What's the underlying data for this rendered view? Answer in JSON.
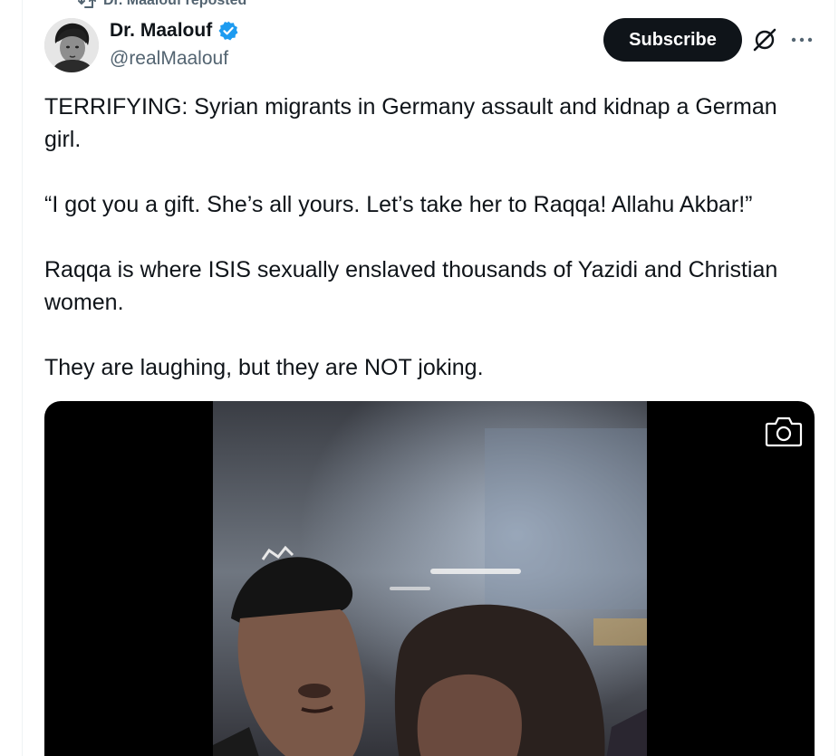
{
  "repost": {
    "text": "Dr. Maalouf reposted",
    "icon": "repost-icon"
  },
  "author": {
    "name": "Dr. Maalouf",
    "handle": "@realMaalouf",
    "verified": true,
    "verified_color": "#1d9bf0"
  },
  "actions": {
    "subscribe_label": "Subscribe",
    "grok_icon": "grok-icon",
    "more_icon": "more-icon"
  },
  "tweet": {
    "paragraphs": [
      "TERRIFYING: Syrian migrants in Germany assault and kidnap a German girl.",
      "“I got you a gift. She’s all yours. Let’s take her to Raqqa! Allahu Akbar!”",
      "Raqqa is where ISIS sexually enslaved thousands of Yazidi and Christian women.",
      "They are laughing, but they are NOT joking."
    ]
  },
  "media": {
    "type": "video",
    "overlay_icon": "camera-icon"
  },
  "colors": {
    "text_primary": "#0f1419",
    "text_secondary": "#536471",
    "button_dark": "#0f1419",
    "border": "#eff3f4"
  }
}
